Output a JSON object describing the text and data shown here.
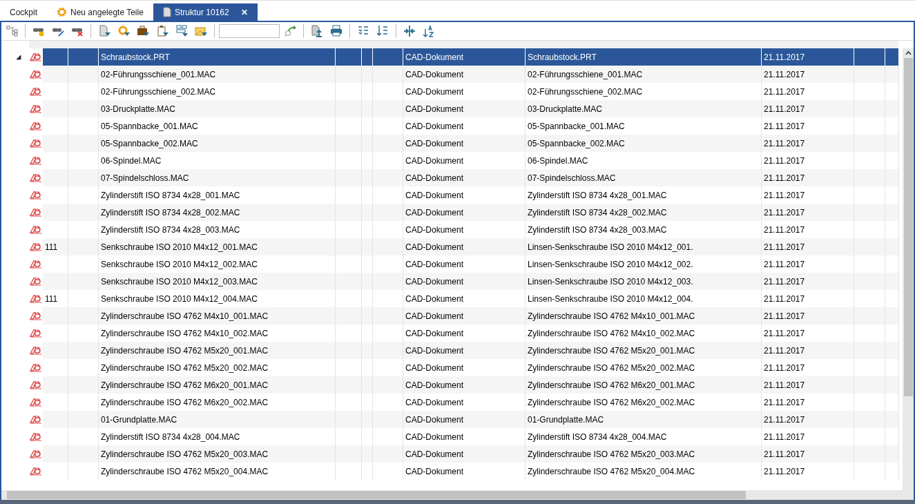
{
  "tabs": [
    {
      "label": "Cockpit",
      "selected": false
    },
    {
      "label": "Neu angelegte Teile",
      "selected": false
    },
    {
      "label": "Struktur 10162",
      "selected": true,
      "close_glyph": "✕"
    }
  ],
  "toolbar": [
    {
      "kind": "button"
    },
    {
      "kind": "separator"
    },
    {
      "kind": "button"
    },
    {
      "kind": "button"
    },
    {
      "kind": "button"
    },
    {
      "kind": "separator"
    },
    {
      "kind": "button"
    },
    {
      "kind": "button"
    },
    {
      "kind": "button"
    },
    {
      "kind": "button"
    },
    {
      "kind": "button"
    },
    {
      "kind": "button"
    },
    {
      "kind": "separator"
    },
    {
      "kind": "search"
    },
    {
      "kind": "button"
    },
    {
      "kind": "separator"
    },
    {
      "kind": "button"
    },
    {
      "kind": "button"
    },
    {
      "kind": "separator"
    },
    {
      "kind": "button"
    },
    {
      "kind": "button"
    },
    {
      "kind": "separator"
    },
    {
      "kind": "button"
    },
    {
      "kind": "button"
    }
  ],
  "tree": {
    "name": "Schraubstock.PRT",
    "type": "CAD-Dokument",
    "description": "Schraubstock.PRT",
    "date": "21.11.2017",
    "selected": true,
    "expanded": true,
    "children": [
      {
        "name": "02-Führungsschiene_001.MAC",
        "type": "CAD-Dokument",
        "description": "02-Führungsschiene_001.MAC",
        "date": "21.11.2017",
        "selected": false
      },
      {
        "name": "02-Führungsschiene_002.MAC",
        "type": "CAD-Dokument",
        "description": "02-Führungsschiene_002.MAC",
        "date": "21.11.2017",
        "selected": false
      },
      {
        "name": "03-Druckplatte.MAC",
        "type": "CAD-Dokument",
        "description": "03-Druckplatte.MAC",
        "date": "21.11.2017",
        "selected": false
      },
      {
        "name": "05-Spannbacke_001.MAC",
        "type": "CAD-Dokument",
        "description": "05-Spannbacke_001.MAC",
        "date": "21.11.2017",
        "selected": false
      },
      {
        "name": "05-Spannbacke_002.MAC",
        "type": "CAD-Dokument",
        "description": "05-Spannbacke_002.MAC",
        "date": "21.11.2017",
        "selected": false
      },
      {
        "name": "06-Spindel.MAC",
        "type": "CAD-Dokument",
        "description": "06-Spindel.MAC",
        "date": "21.11.2017",
        "selected": false
      },
      {
        "name": "07-Spindelschloss.MAC",
        "type": "CAD-Dokument",
        "description": "07-Spindelschloss.MAC",
        "date": "21.11.2017",
        "selected": false
      },
      {
        "name": "Zylinderstift ISO 8734 4x28_001.MAC",
        "type": "CAD-Dokument",
        "description": "Zylinderstift ISO 8734 4x28_001.MAC",
        "date": "21.11.2017",
        "selected": false
      },
      {
        "name": "Zylinderstift ISO 8734 4x28_002.MAC",
        "type": "CAD-Dokument",
        "description": "Zylinderstift ISO 8734 4x28_002.MAC",
        "date": "21.11.2017",
        "selected": false
      },
      {
        "name": "Zylinderstift ISO 8734 4x28_003.MAC",
        "type": "CAD-Dokument",
        "description": "Zylinderstift ISO 8734 4x28_003.MAC",
        "date": "21.11.2017",
        "selected": false
      },
      {
        "name": "Senkschraube ISO 2010 M4x12_001.MAC",
        "number": "111",
        "type": "CAD-Dokument",
        "description": "Linsen-Senkschraube ISO 2010 M4x12_001.",
        "date": "21.11.2017",
        "selected": false
      },
      {
        "name": "Senkschraube ISO 2010 M4x12_002.MAC",
        "type": "CAD-Dokument",
        "description": "Linsen-Senkschraube ISO 2010 M4x12_002.",
        "date": "21.11.2017",
        "selected": false
      },
      {
        "name": "Senkschraube ISO 2010 M4x12_003.MAC",
        "type": "CAD-Dokument",
        "description": "Linsen-Senkschraube ISO 2010 M4x12_003.",
        "date": "21.11.2017",
        "selected": false
      },
      {
        "name": "Senkschraube ISO 2010 M4x12_004.MAC",
        "number": "111",
        "type": "CAD-Dokument",
        "description": "Linsen-Senkschraube ISO 2010 M4x12_004.",
        "date": "21.11.2017",
        "selected": false
      },
      {
        "name": "Zylinderschraube ISO 4762 M4x10_001.MAC",
        "type": "CAD-Dokument",
        "description": "Zylinderschraube ISO 4762 M4x10_001.MAC",
        "date": "21.11.2017",
        "selected": false
      },
      {
        "name": "Zylinderschraube ISO 4762 M4x10_002.MAC",
        "type": "CAD-Dokument",
        "description": "Zylinderschraube ISO 4762 M4x10_002.MAC",
        "date": "21.11.2017",
        "selected": false
      },
      {
        "name": "Zylinderschraube ISO 4762 M5x20_001.MAC",
        "type": "CAD-Dokument",
        "description": "Zylinderschraube ISO 4762 M5x20_001.MAC",
        "date": "21.11.2017",
        "selected": false
      },
      {
        "name": "Zylinderschraube ISO 4762 M5x20_002.MAC",
        "type": "CAD-Dokument",
        "description": "Zylinderschraube ISO 4762 M5x20_002.MAC",
        "date": "21.11.2017",
        "selected": false
      },
      {
        "name": "Zylinderschraube ISO 4762 M6x20_001.MAC",
        "type": "CAD-Dokument",
        "description": "Zylinderschraube ISO 4762 M6x20_001.MAC",
        "date": "21.11.2017",
        "selected": false
      },
      {
        "name": "Zylinderschraube ISO 4762 M6x20_002.MAC",
        "type": "CAD-Dokument",
        "description": "Zylinderschraube ISO 4762 M6x20_002.MAC",
        "date": "21.11.2017",
        "selected": false
      },
      {
        "name": "01-Grundplatte.MAC",
        "type": "CAD-Dokument",
        "description": "01-Grundplatte.MAC",
        "date": "21.11.2017",
        "selected": false
      },
      {
        "name": "Zylinderstift ISO 8734 4x28_004.MAC",
        "type": "CAD-Dokument",
        "description": "Zylinderstift ISO 8734 4x28_004.MAC",
        "date": "21.11.2017",
        "selected": false
      },
      {
        "name": "Zylinderschraube ISO 4762 M5x20_003.MAC",
        "type": "CAD-Dokument",
        "description": "Zylinderschraube ISO 4762 M5x20_003.MAC",
        "date": "21.11.2017",
        "selected": false
      },
      {
        "name": "Zylinderschraube ISO 4762 M5x20_004.MAC",
        "type": "CAD-Dokument",
        "description": "Zylinderschraube ISO 4762 M5x20_004.MAC",
        "date": "21.11.2017",
        "selected": false
      }
    ]
  }
}
